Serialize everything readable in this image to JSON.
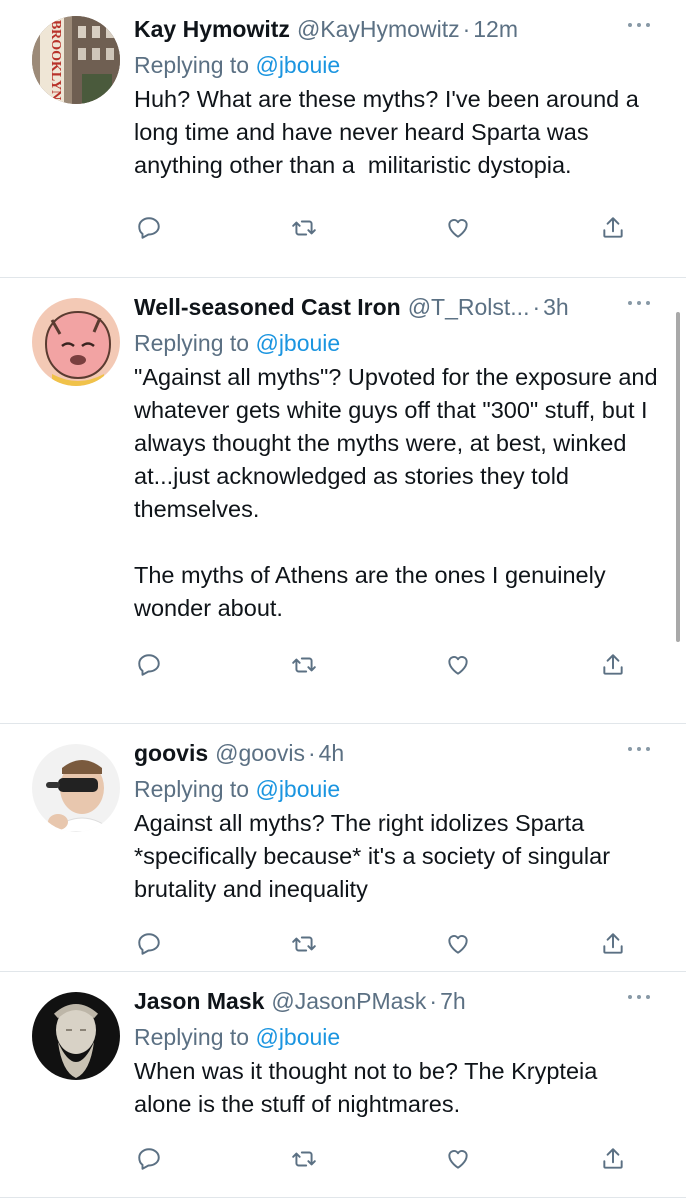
{
  "colors": {
    "accent": "#1b95e0",
    "secondary_text": "#5b7083",
    "divider": "#e1e6ea"
  },
  "tweets": [
    {
      "name": "Kay Hymowitz",
      "handle": "@KayHymowitz",
      "dot": "·",
      "time": "12m",
      "reply_prefix": "Replying to ",
      "reply_to": "@jbouie",
      "text": "Huh? What are these myths? I've been around a long time and have never heard Sparta was anything other than a  militaristic dystopia.",
      "avatar": "BROOKLYN"
    },
    {
      "name": "Well-seasoned Cast Iron",
      "handle": "@T_Rolst...",
      "dot": "·",
      "time": "3h",
      "reply_prefix": "Replying to ",
      "reply_to": "@jbouie",
      "text": "\"Against all myths\"? Upvoted for the exposure and whatever gets white guys off that \"300\" stuff, but I always thought the myths were, at best, winked at...just acknowledged as stories they told themselves.\n\nThe myths of Athens are the ones I genuinely wonder about.",
      "avatar": ""
    },
    {
      "name": "goovis",
      "handle": "@goovis",
      "dot": "·",
      "time": "4h",
      "reply_prefix": "Replying to ",
      "reply_to": "@jbouie",
      "text": "Against all myths? The right idolizes Sparta *specifically because* it's a society of singular brutality and inequality",
      "avatar": ""
    },
    {
      "name": "Jason Mask",
      "handle": "@JasonPMask",
      "dot": "·",
      "time": "7h",
      "reply_prefix": "Replying to ",
      "reply_to": "@jbouie",
      "text": "When was it thought not to be? The Krypteia alone is the stuff of nightmares.",
      "avatar": ""
    }
  ],
  "icons": {
    "reply": "reply-icon",
    "retweet": "retweet-icon",
    "like": "heart-icon",
    "share": "share-icon",
    "more": "more-icon"
  }
}
